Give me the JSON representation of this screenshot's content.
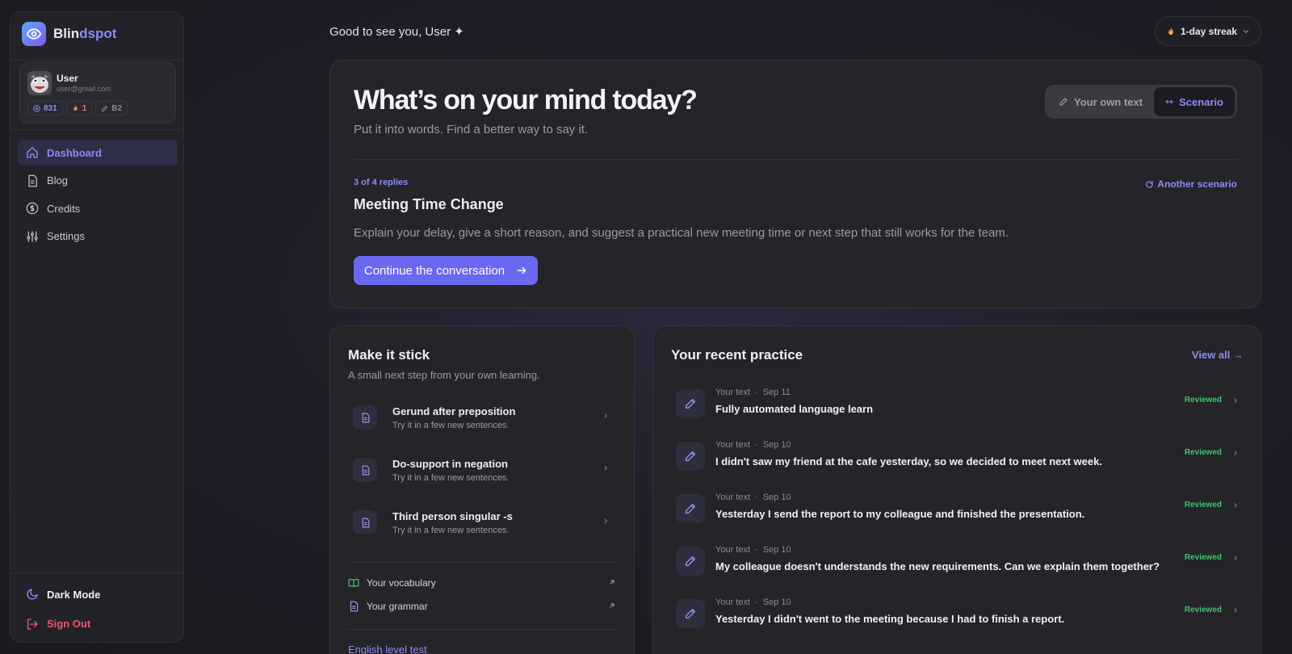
{
  "brand": {
    "name_start": "Blin",
    "name_end": "dspot"
  },
  "user": {
    "name": "User",
    "email": "user@gmail.com",
    "credits": "831",
    "streak": "1",
    "level": "B2"
  },
  "nav": {
    "items": [
      {
        "label": "Dashboard",
        "icon": "home-icon",
        "active": true
      },
      {
        "label": "Blog",
        "icon": "document-icon",
        "active": false
      },
      {
        "label": "Credits",
        "icon": "dollar-icon",
        "active": false
      },
      {
        "label": "Settings",
        "icon": "sliders-icon",
        "active": false
      }
    ],
    "dark_mode": "Dark Mode",
    "sign_out": "Sign Out"
  },
  "header": {
    "greeting": "Good to see you, User ✦",
    "streak_label": "1-day streak"
  },
  "hero": {
    "title": "What’s on your mind today?",
    "subtitle": "Put it into words. Find a better way to say it.",
    "mode_own": "Your own text",
    "mode_scenario": "Scenario",
    "progress": "3 of 4 replies",
    "another": "Another scenario",
    "scenario_title": "Meeting Time Change",
    "scenario_desc": "Explain your delay, give a short reason, and suggest a practical new meeting time or next step that still works for the team.",
    "cta": "Continue the conversation"
  },
  "stick": {
    "title": "Make it stick",
    "subtitle": "A small next step from your own learning.",
    "items": [
      {
        "name": "Gerund after preposition",
        "hint": "Try it in a few new sentences."
      },
      {
        "name": "Do-support in negation",
        "hint": "Try it in a few new sentences."
      },
      {
        "name": "Third person singular -s",
        "hint": "Try it in a few new sentences."
      }
    ],
    "vocabulary": "Your vocabulary",
    "grammar": "Your grammar",
    "level_test": "English level test"
  },
  "recent": {
    "title": "Your recent practice",
    "view_all": "View all →",
    "items": [
      {
        "type": "Your text",
        "date": "Sep 11",
        "text": "Fully automated language learn",
        "status": "Reviewed"
      },
      {
        "type": "Your text",
        "date": "Sep 10",
        "text": "I didn't saw my friend at the cafe yesterday, so we decided to meet next week.",
        "status": "Reviewed"
      },
      {
        "type": "Your text",
        "date": "Sep 10",
        "text": "Yesterday I send the report to my colleague and finished the presentation.",
        "status": "Reviewed"
      },
      {
        "type": "Your text",
        "date": "Sep 10",
        "text": "My colleague doesn't understands the new requirements. Can we explain them together?",
        "status": "Reviewed"
      },
      {
        "type": "Your text",
        "date": "Sep 10",
        "text": "Yesterday I didn't went to the meeting because I had to finish a report.",
        "status": "Reviewed"
      }
    ]
  },
  "colors": {
    "accent": "#8d8cf5",
    "cta": "#6a68f0",
    "success": "#3dc46f",
    "danger": "#f0566e"
  }
}
